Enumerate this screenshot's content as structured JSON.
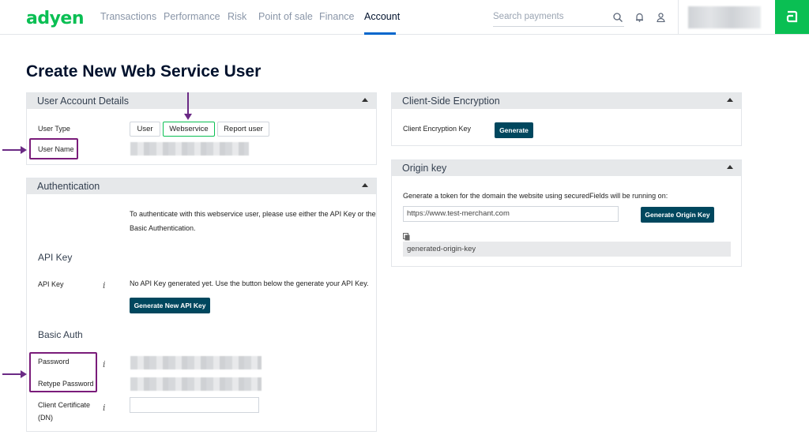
{
  "app": {
    "logo": "adyen",
    "accent": "#0abf53"
  },
  "nav": {
    "items": [
      "Transactions",
      "Performance",
      "Risk",
      "Point of sale",
      "Finance",
      "Account"
    ],
    "active": "Account"
  },
  "search": {
    "placeholder": "Search payments"
  },
  "page": {
    "title": "Create New Web Service User"
  },
  "user_account": {
    "title": "User Account Details",
    "user_type_label": "User Type",
    "user_types": [
      "User",
      "Webservice",
      "Report user"
    ],
    "selected_type": "Webservice",
    "user_name_label": "User Name"
  },
  "auth": {
    "title": "Authentication",
    "intro_1": "To authenticate with this webservice user, please use either the API Key or the",
    "intro_2": "Basic Authentication.",
    "api_key_heading": "API Key",
    "api_key_label": "API Key",
    "api_key_info": "i",
    "api_key_text": "No API Key generated yet. Use the button below the generate your API Key.",
    "generate_api_key_label": "Generate New API Key",
    "basic_auth_heading": "Basic Auth",
    "password_label": "Password",
    "password_info": "i",
    "retype_password_label": "Retype Password",
    "client_cert_label_1": "Client Certificate",
    "client_cert_label_2": "(DN)",
    "client_cert_info": "i"
  },
  "cse": {
    "title": "Client-Side Encryption",
    "key_label": "Client Encryption Key",
    "generate_label": "Generate"
  },
  "origin": {
    "title": "Origin key",
    "description": "Generate a token for the domain the website using securedFields will be running on:",
    "domain_value": "https://www.test-merchant.com",
    "generate_label": "Generate Origin Key",
    "key_value": "generated-origin-key"
  },
  "annotations": {
    "color": "#6b2a85"
  }
}
